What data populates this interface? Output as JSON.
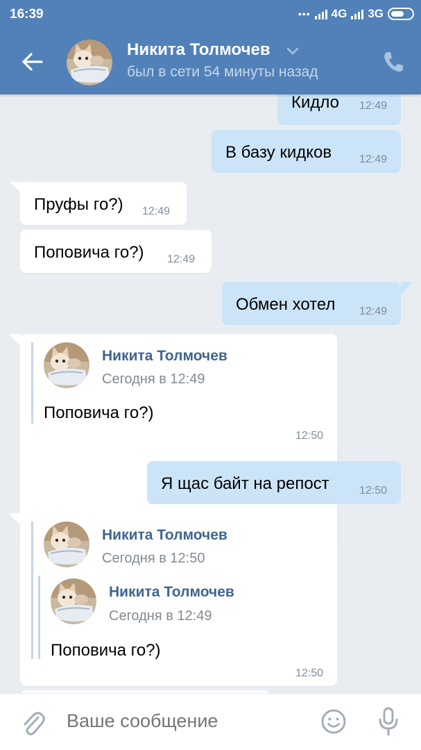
{
  "status_bar": {
    "time": "16:39",
    "net1": "4G",
    "net2": "3G"
  },
  "header": {
    "name": "Никита Толмочев",
    "status": "был в сети 54 минуты назад"
  },
  "messages": [
    {
      "text": "Кидло",
      "time": "12:49",
      "dir": "out"
    },
    {
      "text": "В базу кидков",
      "time": "12:49",
      "dir": "out"
    },
    {
      "text": "Пруфы го?)",
      "time": "12:49",
      "dir": "in"
    },
    {
      "text": "Поповича го?)",
      "time": "12:49",
      "dir": "in"
    },
    {
      "text": "Обмен хотел",
      "time": "12:49",
      "dir": "out"
    },
    {
      "dir": "in",
      "time": "12:50",
      "forward": {
        "author": "Никита Толмочев",
        "date": "Сегодня в 12:49",
        "text": "Поповича го?)"
      }
    },
    {
      "text": "Я щас байт на репост",
      "time": "12:50",
      "dir": "out"
    },
    {
      "dir": "in",
      "time": "12:50",
      "forward": {
        "author": "Никита Толмочев",
        "date": "Сегодня в 12:50",
        "forward": {
          "author": "Никита Толмочев",
          "date": "Сегодня в 12:49",
          "text": "Поповича го?)"
        }
      }
    }
  ],
  "composer": {
    "placeholder": "Ваше сообщение"
  },
  "colors": {
    "header": "#5181b8",
    "outgoing": "#cce4f7",
    "incoming": "#ffffff",
    "background": "#e9edf2",
    "link": "#40648e"
  },
  "icons": [
    "back-arrow-icon",
    "chevron-down-icon",
    "phone-icon",
    "attach-icon",
    "emoji-icon",
    "mic-icon"
  ]
}
